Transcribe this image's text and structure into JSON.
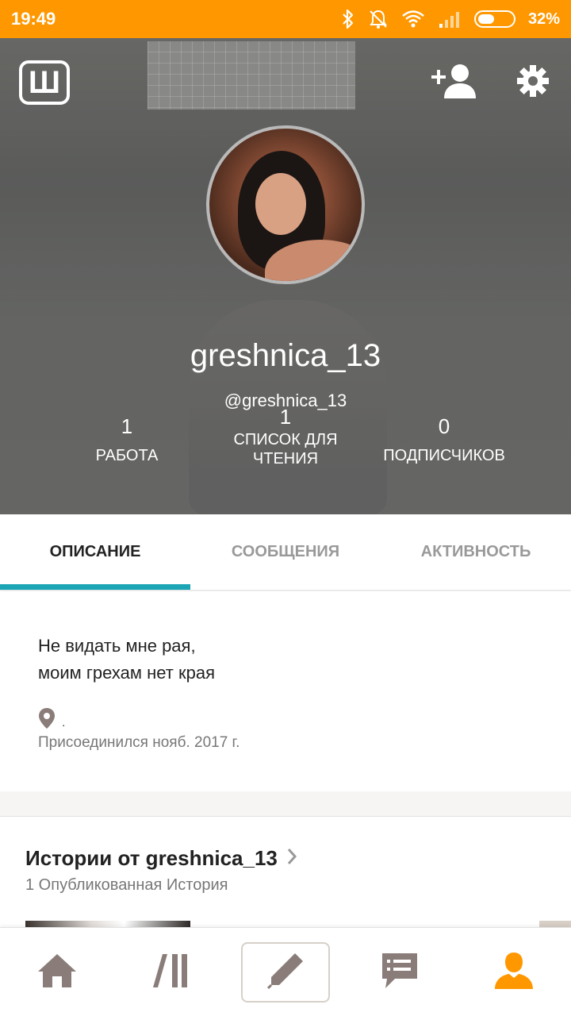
{
  "status_bar": {
    "time": "19:49",
    "battery_percent": "32%",
    "battery_level": 0.32,
    "icons": [
      "bluetooth-icon",
      "do-not-disturb-icon",
      "wifi-icon",
      "signal-icon",
      "battery-icon"
    ],
    "background": "#ff9800"
  },
  "header": {
    "logo_letter": "Ш",
    "username": "greshnica_13",
    "handle": "@greshnica_13",
    "stats": [
      {
        "value": "1",
        "label": "РАБОТА"
      },
      {
        "value": "1",
        "label": "СПИСОК ДЛЯ ЧТЕНИЯ"
      },
      {
        "value": "0",
        "label": "ПОДПИСЧИКОВ"
      }
    ]
  },
  "tabs": [
    {
      "label": "ОПИСАНИЕ",
      "active": true
    },
    {
      "label": "СООБЩЕНИЯ",
      "active": false
    },
    {
      "label": "АКТИВНОСТЬ",
      "active": false
    }
  ],
  "about": {
    "bio": "Не видать мне рая,\nмоим грехам нет края",
    "location": ".",
    "joined": "Присоединился нояб. 2017 г."
  },
  "stories": {
    "title": "Истории от greshnica_13",
    "subtitle": "1 Опубликованная История"
  },
  "colors": {
    "accent_tab": "#1ba5b5",
    "profile_active": "#ff9800",
    "icon_gray": "#8a7d79"
  },
  "bottom_nav": [
    "home-icon",
    "library-icon",
    "write-icon",
    "messages-icon",
    "profile-icon"
  ]
}
